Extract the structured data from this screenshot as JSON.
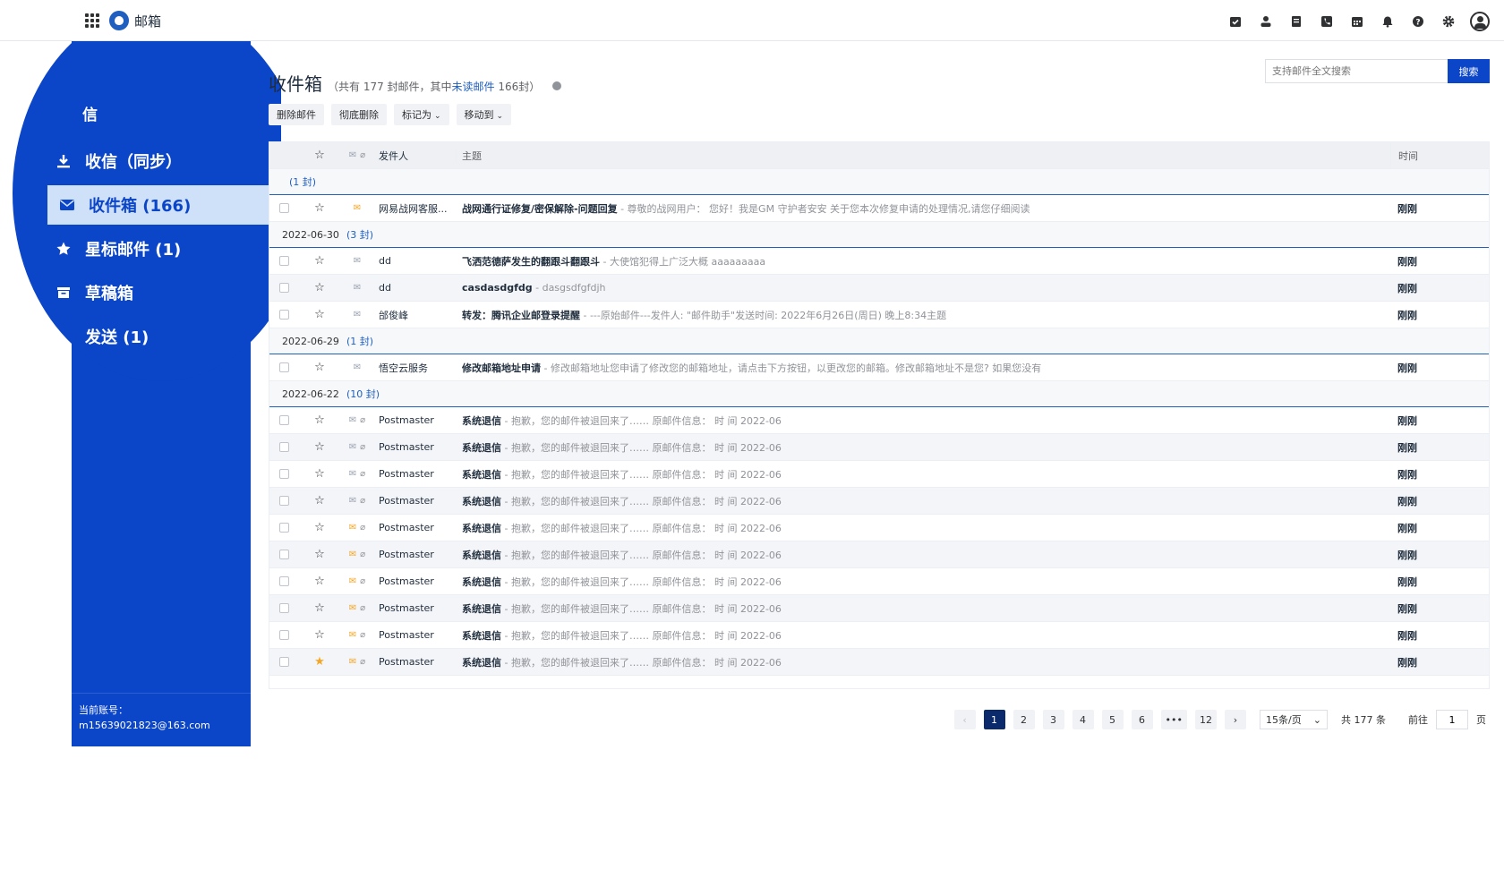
{
  "header": {
    "app_title": "邮箱",
    "icons": [
      "apps-grid-icon",
      "logo-icon",
      "task-icon",
      "contacts-icon",
      "notes-icon",
      "phone-icon",
      "calendar-icon",
      "bell-icon",
      "help-icon",
      "settings-icon",
      "avatar-icon"
    ]
  },
  "sidebar": {
    "top_label": "信",
    "items": [
      {
        "label": "收信（同步）",
        "icon": "download-icon"
      },
      {
        "label": "收件箱 (166)",
        "icon": "envelope-icon"
      },
      {
        "label": "星标邮件 (1)",
        "icon": "star-icon"
      },
      {
        "label": "草稿箱",
        "icon": "draft-icon"
      },
      {
        "label": "发送 (1)",
        "icon": "send-icon"
      }
    ],
    "account_label": "当前账号：",
    "account_email": "m15639021823@163.com"
  },
  "main": {
    "title": "收件箱",
    "subtitle_pre": "（共有 177 封邮件，其中",
    "subtitle_link": "未读邮件",
    "subtitle_post": "166封）",
    "search_placeholder": "支持邮件全文搜索",
    "search_button": "搜索",
    "toolbar": {
      "delete": "删除邮件",
      "purge": "彻底删除",
      "mark": "标记为",
      "move": "移动到"
    },
    "columns": {
      "from": "发件人",
      "subject": "主题",
      "time": "时间"
    },
    "groups": [
      {
        "date": "",
        "count": "(1 封)",
        "rows": [
          {
            "from": "网易战网客服...",
            "subject": "战网通行证修复/密保解除-问题回复",
            "preview": " - 尊敬的战网用户： 您好！我是GM 守护者安安 关于您本次修复申请的处理情况,请您仔细阅读",
            "time": "刚刚",
            "env": "orange",
            "attach": false,
            "starred": false
          }
        ]
      },
      {
        "date": "2022-06-30",
        "count": "(3 封)",
        "rows": [
          {
            "from": "dd",
            "subject": "飞洒范德萨发生的翻跟斗翻跟斗",
            "preview": " - 大使馆犯得上广泛大概 aaaaaaaaa",
            "time": "刚刚",
            "env": "gray",
            "attach": false,
            "starred": false
          },
          {
            "from": "dd",
            "subject": "casdasdgfdg",
            "preview": " - dasgsdfgfdjh",
            "time": "刚刚",
            "env": "gray",
            "attach": false,
            "starred": false
          },
          {
            "from": "邰俊峰",
            "subject": "转发：腾讯企业邮登录提醒",
            "preview": " - ---原始邮件---发件人: \"邮件助手\"发送时间: 2022年6月26日(周日) 晚上8:34主题",
            "time": "刚刚",
            "env": "gray",
            "attach": false,
            "starred": false
          }
        ]
      },
      {
        "date": "2022-06-29",
        "count": "(1 封)",
        "rows": [
          {
            "from": "悟空云服务",
            "subject": "修改邮箱地址申请",
            "preview": " - 修改邮箱地址您申请了修改您的邮箱地址，请点击下方按钮，以更改您的邮箱。修改邮箱地址不是您? 如果您没有",
            "time": "刚刚",
            "env": "gray",
            "attach": false,
            "starred": false
          }
        ]
      },
      {
        "date": "2022-06-22",
        "count": "(10 封)",
        "rows": [
          {
            "from": "Postmaster",
            "subject": "系统退信",
            "preview": " - 抱歉，您的邮件被退回来了…… 原邮件信息： 时 间 2022-06",
            "time": "刚刚",
            "env": "gray",
            "attach": true,
            "starred": false
          },
          {
            "from": "Postmaster",
            "subject": "系统退信",
            "preview": " - 抱歉，您的邮件被退回来了…… 原邮件信息： 时 间 2022-06",
            "time": "刚刚",
            "env": "gray",
            "attach": true,
            "starred": false
          },
          {
            "from": "Postmaster",
            "subject": "系统退信",
            "preview": " - 抱歉，您的邮件被退回来了…… 原邮件信息： 时 间 2022-06",
            "time": "刚刚",
            "env": "gray",
            "attach": true,
            "starred": false
          },
          {
            "from": "Postmaster",
            "subject": "系统退信",
            "preview": " - 抱歉，您的邮件被退回来了…… 原邮件信息： 时 间 2022-06",
            "time": "刚刚",
            "env": "gray",
            "attach": true,
            "starred": false
          },
          {
            "from": "Postmaster",
            "subject": "系统退信",
            "preview": " - 抱歉，您的邮件被退回来了…… 原邮件信息： 时 间 2022-06",
            "time": "刚刚",
            "env": "orange",
            "attach": true,
            "starred": false
          },
          {
            "from": "Postmaster",
            "subject": "系统退信",
            "preview": " - 抱歉，您的邮件被退回来了…… 原邮件信息： 时 间 2022-06",
            "time": "刚刚",
            "env": "orange",
            "attach": true,
            "starred": false
          },
          {
            "from": "Postmaster",
            "subject": "系统退信",
            "preview": " - 抱歉，您的邮件被退回来了…… 原邮件信息： 时 间 2022-06",
            "time": "刚刚",
            "env": "orange",
            "attach": true,
            "starred": false
          },
          {
            "from": "Postmaster",
            "subject": "系统退信",
            "preview": " - 抱歉，您的邮件被退回来了…… 原邮件信息： 时 间 2022-06",
            "time": "刚刚",
            "env": "orange",
            "attach": true,
            "starred": false
          },
          {
            "from": "Postmaster",
            "subject": "系统退信",
            "preview": " - 抱歉，您的邮件被退回来了…… 原邮件信息： 时 间 2022-06",
            "time": "刚刚",
            "env": "orange",
            "attach": true,
            "starred": false
          },
          {
            "from": "Postmaster",
            "subject": "系统退信",
            "preview": " - 抱歉，您的邮件被退回来了…… 原邮件信息： 时 间 2022-06",
            "time": "刚刚",
            "env": "orange",
            "attach": true,
            "starred": true
          }
        ]
      }
    ],
    "pagination": {
      "pages": [
        "1",
        "2",
        "3",
        "4",
        "5",
        "6",
        "•••",
        "12"
      ],
      "current": "1",
      "page_size": "15条/页",
      "total": "共 177 条",
      "goto_label": "前往",
      "goto_value": "1",
      "page_suffix": "页"
    }
  },
  "colors": {
    "brand_blue": "#0b45c8",
    "active_bg": "#cfe0f9",
    "unread_orange": "#f5a623"
  }
}
